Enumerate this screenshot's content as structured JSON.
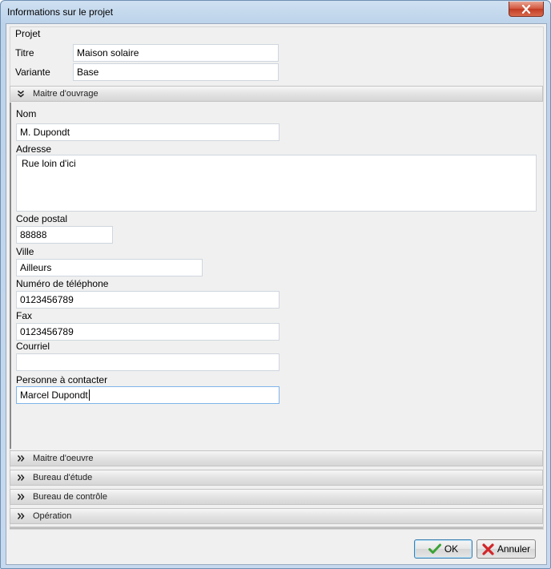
{
  "window": {
    "title": "Informations sur le projet"
  },
  "projet": {
    "group_label": "Projet",
    "titre_label": "Titre",
    "titre_value": "Maison solaire",
    "variante_label": "Variante",
    "variante_value": "Base"
  },
  "sections": {
    "maitre_ouvrage": "Maitre d'ouvrage",
    "maitre_oeuvre": "Maitre d'oeuvre",
    "bureau_etude": "Bureau d'étude",
    "bureau_controle": "Bureau de contrôle",
    "operation": "Opération"
  },
  "maitre_ouvrage": {
    "nom_label": "Nom",
    "nom_value": "M. Dupondt",
    "adresse_label": "Adresse",
    "adresse_value": "Rue loin d'ici",
    "code_postal_label": "Code postal",
    "code_postal_value": "88888",
    "ville_label": "Ville",
    "ville_value": "Ailleurs",
    "telephone_label": "Numéro de téléphone",
    "telephone_value": "0123456789",
    "fax_label": "Fax",
    "fax_value": "0123456789",
    "courriel_label": "Courriel",
    "courriel_value": "",
    "contact_label": "Personne à contacter",
    "contact_value": "Marcel Dupondt"
  },
  "buttons": {
    "ok": "OK",
    "annuler": "Annuler"
  },
  "icons": {
    "close": "close-icon",
    "expanded": "chevron-double-down-icon",
    "collapsed": "chevron-double-right-icon",
    "ok": "checkmark-icon",
    "cancel": "cross-icon"
  },
  "colors": {
    "ok_icon": "#3aa336",
    "cancel_icon": "#d2262a",
    "focus_border": "#7eb4ea"
  }
}
